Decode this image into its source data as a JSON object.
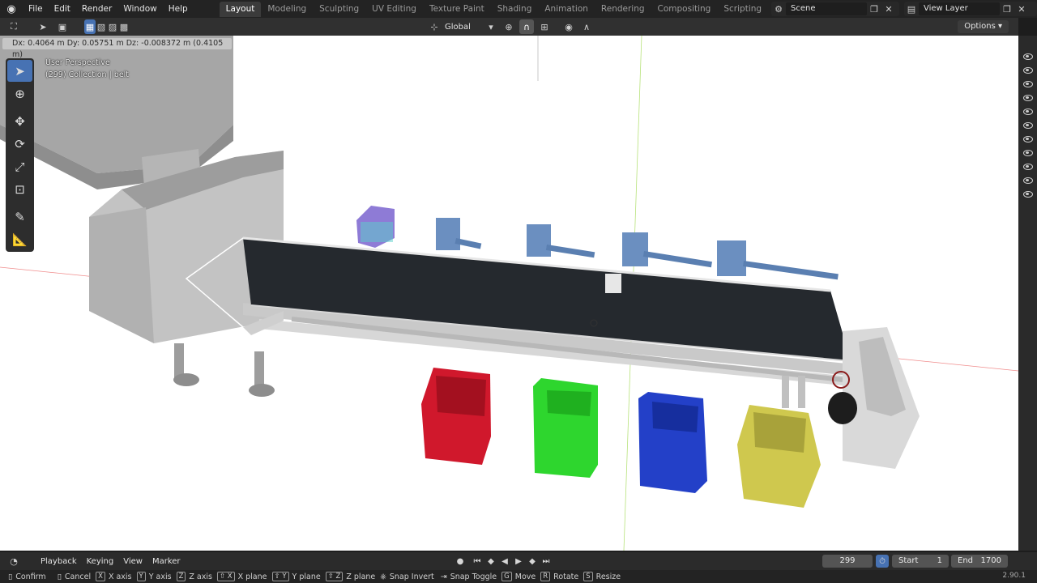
{
  "menu": [
    "File",
    "Edit",
    "Render",
    "Window",
    "Help"
  ],
  "workspace_tabs": [
    "Layout",
    "Modeling",
    "Sculpting",
    "UV Editing",
    "Texture Paint",
    "Shading",
    "Animation",
    "Rendering",
    "Compositing",
    "Scripting"
  ],
  "active_tab": "Layout",
  "scene": {
    "name": "Scene"
  },
  "view_layer": {
    "name": "View Layer"
  },
  "header": {
    "orientation": "Global",
    "options_label": "Options"
  },
  "drag_info": "Dx: 0.4064 m  Dy: 0.05751 m  Dz: -0.008372 m (0.4105 m)",
  "viewport": {
    "perspective": "User Perspective",
    "collection": "(299) Collection | belt"
  },
  "timeline": {
    "menus": [
      "Playback",
      "Keying",
      "View",
      "Marker"
    ],
    "current_frame": "299",
    "start_label": "Start",
    "start": "1",
    "end_label": "End",
    "end": "1700"
  },
  "status": [
    {
      "key": "",
      "label": "Confirm"
    },
    {
      "key": "",
      "label": "Cancel"
    },
    {
      "key": "X",
      "label": "X axis"
    },
    {
      "key": "Y",
      "label": "Y axis"
    },
    {
      "key": "Z",
      "label": "Z axis"
    },
    {
      "key": "⇧ X",
      "label": "X plane"
    },
    {
      "key": "⇧ Y",
      "label": "Y plane"
    },
    {
      "key": "⇧ Z",
      "label": "Z plane"
    },
    {
      "key": "",
      "label": "Snap Invert"
    },
    {
      "key": "",
      "label": "Snap Toggle"
    },
    {
      "key": "G",
      "label": "Move"
    },
    {
      "key": "R",
      "label": "Rotate"
    },
    {
      "key": "S",
      "label": "Resize"
    }
  ],
  "version": "2.90.1",
  "colors": {
    "bin_red": "#d0182c",
    "bin_green": "#2ed62e",
    "bin_blue": "#2340c8",
    "bin_yellow": "#cfc84e",
    "belt": "#26292d",
    "accent": "#4772b3"
  }
}
